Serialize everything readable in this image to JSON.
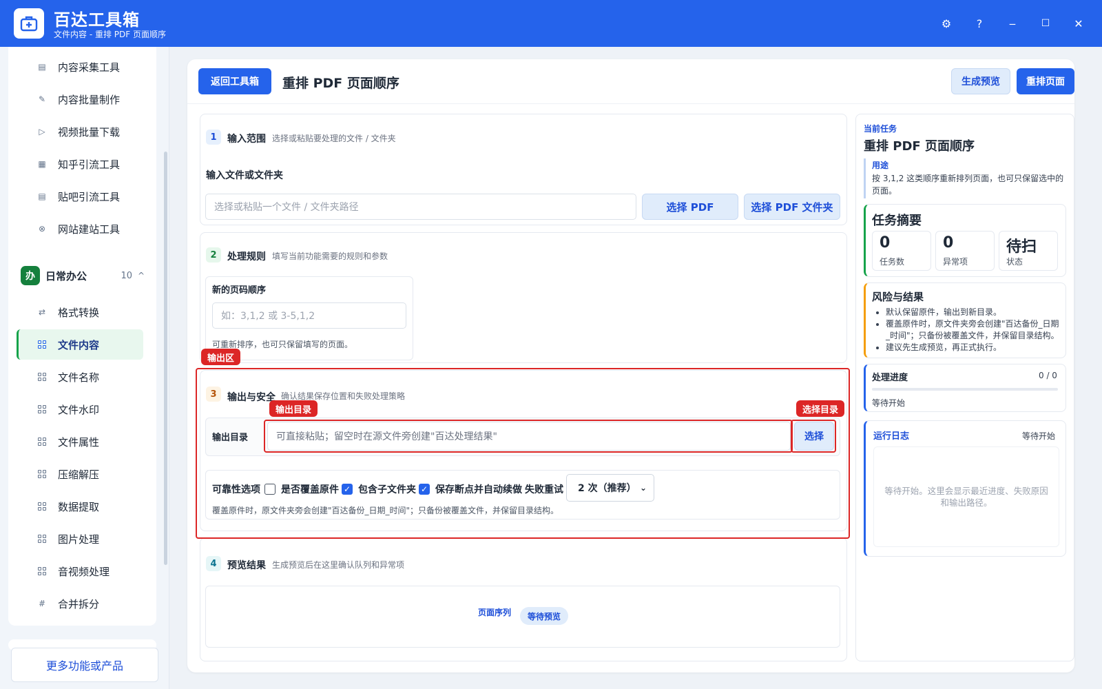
{
  "app": {
    "title": "百达工具箱",
    "subtitle": "文件内容 - 重排 PDF 页面顺序"
  },
  "window_controls": {
    "settings": "⚙",
    "help": "?",
    "minimize": "‒",
    "maximize": "☐",
    "close": "✕"
  },
  "sidebar": {
    "top_items": [
      {
        "label": "内容采集工具",
        "icon": "collect-icon"
      },
      {
        "label": "内容批量制作",
        "icon": "pencil-icon"
      },
      {
        "label": "视频批量下载",
        "icon": "video-icon"
      },
      {
        "label": "知乎引流工具",
        "icon": "zhihu-icon"
      },
      {
        "label": "贴吧引流工具",
        "icon": "tieba-icon"
      },
      {
        "label": "网站建站工具",
        "icon": "web-icon"
      }
    ],
    "group": {
      "badge": "办",
      "label": "日常办公",
      "count": "10",
      "caret": "^"
    },
    "group_items": [
      {
        "label": "格式转换",
        "icon": "swap-icon"
      },
      {
        "label": "文件内容",
        "icon": "grid-icon",
        "active": true
      },
      {
        "label": "文件名称",
        "icon": "grid-icon"
      },
      {
        "label": "文件水印",
        "icon": "grid-icon"
      },
      {
        "label": "文件属性",
        "icon": "grid-icon"
      },
      {
        "label": "压缩解压",
        "icon": "grid-icon"
      },
      {
        "label": "数据提取",
        "icon": "grid-icon"
      },
      {
        "label": "图片处理",
        "icon": "grid-icon"
      },
      {
        "label": "音视频处理",
        "icon": "grid-icon"
      },
      {
        "label": "合并拆分",
        "icon": "hash-icon"
      }
    ],
    "more_label": "更多功能或产品"
  },
  "header": {
    "back_label": "返回工具箱",
    "title": "重排 PDF 页面顺序",
    "preview_label": "生成预览",
    "run_label": "重排页面"
  },
  "sections": {
    "input": {
      "num": "1",
      "title": "输入范围",
      "desc": "选择或粘贴要处理的文件 / 文件夹",
      "field_label": "输入文件或文件夹",
      "placeholder": "选择或粘贴一个文件 / 文件夹路径",
      "btn_pdf": "选择 PDF",
      "btn_folder": "选择 PDF 文件夹"
    },
    "rules": {
      "num": "2",
      "title": "处理规则",
      "desc": "填写当前功能需要的规则和参数",
      "field_label": "新的页码顺序",
      "placeholder": "如：3,1,2 或 3-5,1,2",
      "hint": "可重新排序，也可只保留填写的页面。"
    },
    "output": {
      "num": "3",
      "title": "输出与安全",
      "desc": "确认结果保存位置和失败处理策略",
      "dir_label": "输出目录",
      "dir_placeholder": "可直接粘贴；留空时在源文件旁创建\"百达处理结果\"",
      "choose_label": "选择",
      "options_label": "可靠性选项",
      "overwrite_label": "是否覆盖原件",
      "overwrite_checked": false,
      "subfolders_label": "包含子文件夹",
      "subfolders_checked": true,
      "resume_label": "保存断点并自动续做",
      "resume_checked": true,
      "retry_label": "失败重试",
      "retry_value": "2 次（推荐）",
      "note": "覆盖原件时，原文件夹旁会创建\"百达备份_日期_时间\"；只备份被覆盖文件，并保留目录结构。"
    },
    "preview": {
      "num": "4",
      "title": "预览结果",
      "desc": "生成预览后在这里确认队列和异常项",
      "list_label": "页面序列",
      "status": "等待预览"
    }
  },
  "annotations": {
    "output_area": "输出区",
    "output_dir": "输出目录",
    "choose_dir": "选择目录"
  },
  "right": {
    "task_small": "当前任务",
    "task_title": "重排 PDF 页面顺序",
    "purpose_label": "用途",
    "purpose_text": "按 3,1,2 这类顺序重新排列页面，也可只保留选中的页面。",
    "summary_title": "任务摘要",
    "stats": [
      {
        "value": "0",
        "label": "任务数"
      },
      {
        "value": "0",
        "label": "异常项"
      },
      {
        "value": "待扫",
        "label": "状态"
      }
    ],
    "risk_title": "风险与结果",
    "risk_items": [
      "默认保留原件，输出到新目录。",
      "覆盖原件时，原文件夹旁会创建\"百达备份_日期_时间\"；只备份被覆盖文件，并保留目录结构。",
      "建议先生成预览，再正式执行。"
    ],
    "progress_title": "处理进度",
    "progress_count": "0 / 0",
    "progress_fraction": 0,
    "progress_status": "等待开始",
    "log_title": "运行日志",
    "log_status": "等待开始",
    "log_placeholder": "等待开始。这里会显示最近进度、失败原因和输出路径。"
  },
  "colors": {
    "brand": "#2563eb",
    "annotation_red": "#dc2626",
    "active_green": "#16a34a",
    "accent_orange": "#f59e0b"
  }
}
